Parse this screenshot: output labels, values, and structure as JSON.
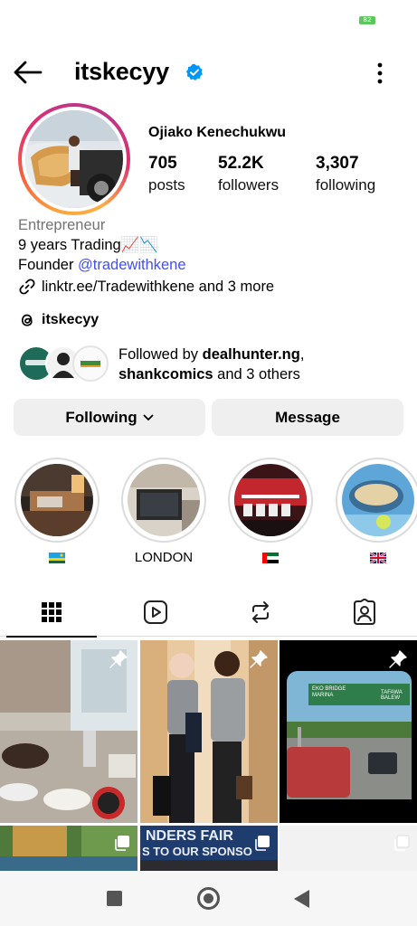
{
  "status_bar": {
    "battery_text": "82"
  },
  "header": {
    "username": "itskecyy",
    "verified_icon": "verified-badge-icon",
    "back_icon": "arrow-left-icon",
    "menu_icon": "more-vertical-icon"
  },
  "profile": {
    "full_name": "Ojiako Kenechukwu",
    "stats": [
      {
        "value": "705",
        "label": "posts"
      },
      {
        "value": "52.2K",
        "label": "followers"
      },
      {
        "value": "3,307",
        "label": "following"
      }
    ],
    "category": "Entrepreneur",
    "bio_line1": "9 years Trading📈📉",
    "bio_line2_prefix": "Founder ",
    "bio_line2_mention": "@tradewithkene",
    "link_text": "linktr.ee/Tradewithkene and 3 more",
    "threads_handle": "itskecyy"
  },
  "followed_by": {
    "prefix": "Followed by ",
    "name1": "dealhunter.ng",
    "sep": ",",
    "name2": "shankcomics",
    "suffix": " and 3 others"
  },
  "buttons": {
    "following_label": "Following",
    "message_label": "Message"
  },
  "highlights": [
    {
      "label": "",
      "flag": "rwanda-flag-icon"
    },
    {
      "label": "LONDON",
      "flag": ""
    },
    {
      "label": "",
      "flag": "uae-flag-icon"
    },
    {
      "label": "",
      "flag": "uk-flag-icon"
    }
  ],
  "tabs": [
    "grid-icon",
    "reels-icon",
    "reposts-icon",
    "tagged-icon"
  ],
  "grid_posts": [
    {
      "type": "pinned"
    },
    {
      "type": "pinned"
    },
    {
      "type": "pinned",
      "sign_line1": "EKO BRIDGE",
      "sign_line2": "MARINA",
      "sign_line3": "TAFAWA BALEW"
    },
    {
      "type": "carousel"
    },
    {
      "type": "carousel",
      "banner_line1": "NDERS FAIR",
      "banner_line2": "S TO OUR SPONSO"
    },
    {
      "type": "carousel"
    }
  ],
  "colors": {
    "mention": "#4150f7",
    "button_bg": "#efefef",
    "verified": "#0095f6",
    "muted": "#737373"
  }
}
